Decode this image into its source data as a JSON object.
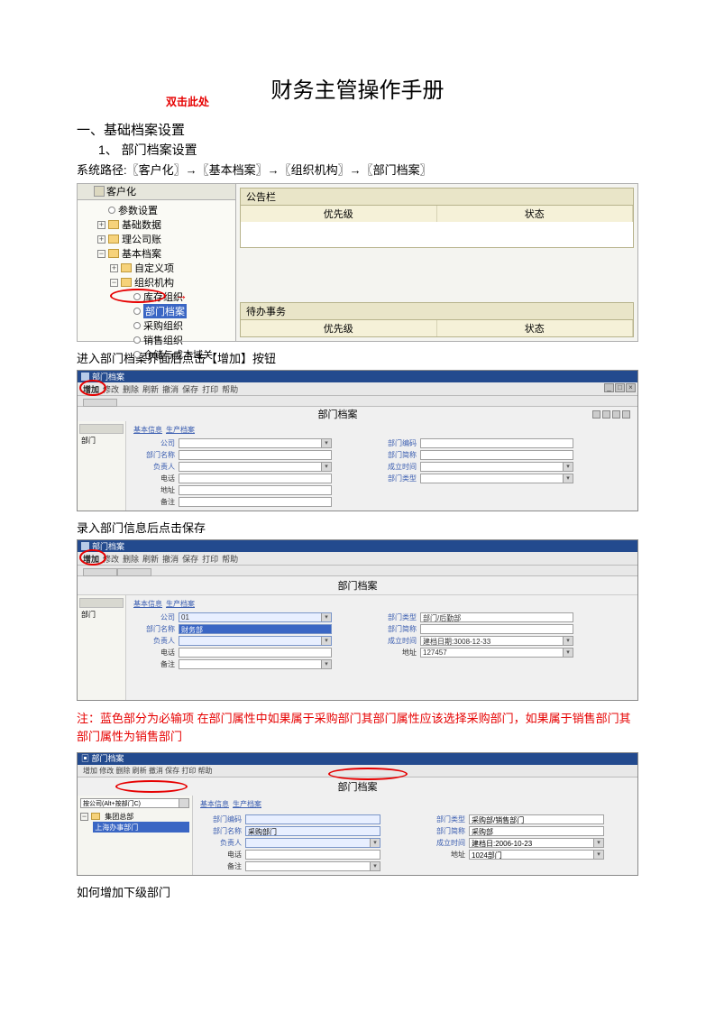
{
  "title": "财务主管操作手册",
  "section1": {
    "num": "一、基础档案设置",
    "sub": "1、 部门档案设置",
    "path": "系统路径:〖客户化〗→〖基本档案〗→〖组织机构〗→〖部门档案〗"
  },
  "ss1": {
    "header": "客户化",
    "tree": [
      "参数设置",
      "基础数据",
      "理公司账",
      "基本档案",
      "自定义项",
      "组织机构",
      "库存组织",
      "部门档案",
      "采购组织",
      "销售组织",
      "仓储与成本域关"
    ],
    "callout": "双击此处",
    "bulletin1": {
      "title": "公告栏",
      "col1": "优先级",
      "col2": "状态"
    },
    "bulletin2": {
      "title": "待办事务",
      "col1": "优先级",
      "col2": "状态"
    }
  },
  "caption2": "进入部门档案界面后点击【增加】按钮",
  "ss2": {
    "winTitle": "部门档案",
    "menu": [
      "增加",
      "修改",
      "删除",
      "刷新",
      "撤消",
      "保存",
      "打印",
      "帮助"
    ],
    "title": "部门档案",
    "leftRoot": "部门",
    "links": [
      "基本信息",
      "生产档案"
    ],
    "labels": {
      "l1": "公司",
      "l2": "部门编码",
      "l3": "部门名称",
      "l4": "部门简称",
      "l5": "负责人",
      "l6": "电话",
      "l7": "成立时间",
      "l8": "部门类型",
      "l9": "地址",
      "l10": "备注"
    }
  },
  "caption3": "录入部门信息后点击保存",
  "ss3": {
    "title": "部门档案",
    "leftRoot": "部门",
    "values": {
      "company": "01",
      "deptCode": "",
      "deptType": "部门/后勤部",
      "deptName": "财务部",
      "shortName": "",
      "respPerson": "",
      "establishDate": "建档日期:3008-12-33",
      "phone": "",
      "address": "127457",
      "memo": ""
    }
  },
  "note": "注：蓝色部分为必输项  在部门属性中如果属于采购部门其部门属性应该选择采购部门，如果属于销售部门其部门属性为销售部门",
  "ss4": {
    "winTitle": "部门档案",
    "menu": "增加  修改  删除  刷新  撤消  保存  打印  帮助",
    "title": "部门档案",
    "combo": "按公司(Alt+按部门C)",
    "treeRoot": "集团总部",
    "treeNode": "上海办事部门",
    "links": [
      "基本信息",
      "生产档案"
    ],
    "labels": {
      "l1": "部门编码",
      "l2": "部门名称",
      "l3": "部门类型",
      "l4": "部门简称",
      "l5": "负责人",
      "l6": "成立时间",
      "l7": "电话",
      "l8": "地址",
      "l9": "备注"
    },
    "vals": {
      "name": "采购部门",
      "type": "采购部/销售部门",
      "short": "采购部",
      "date": "建档日:2006-10-23",
      "resp": "",
      "addr": "1024部门",
      "phone": ""
    }
  },
  "caption4": "如何增加下级部门"
}
